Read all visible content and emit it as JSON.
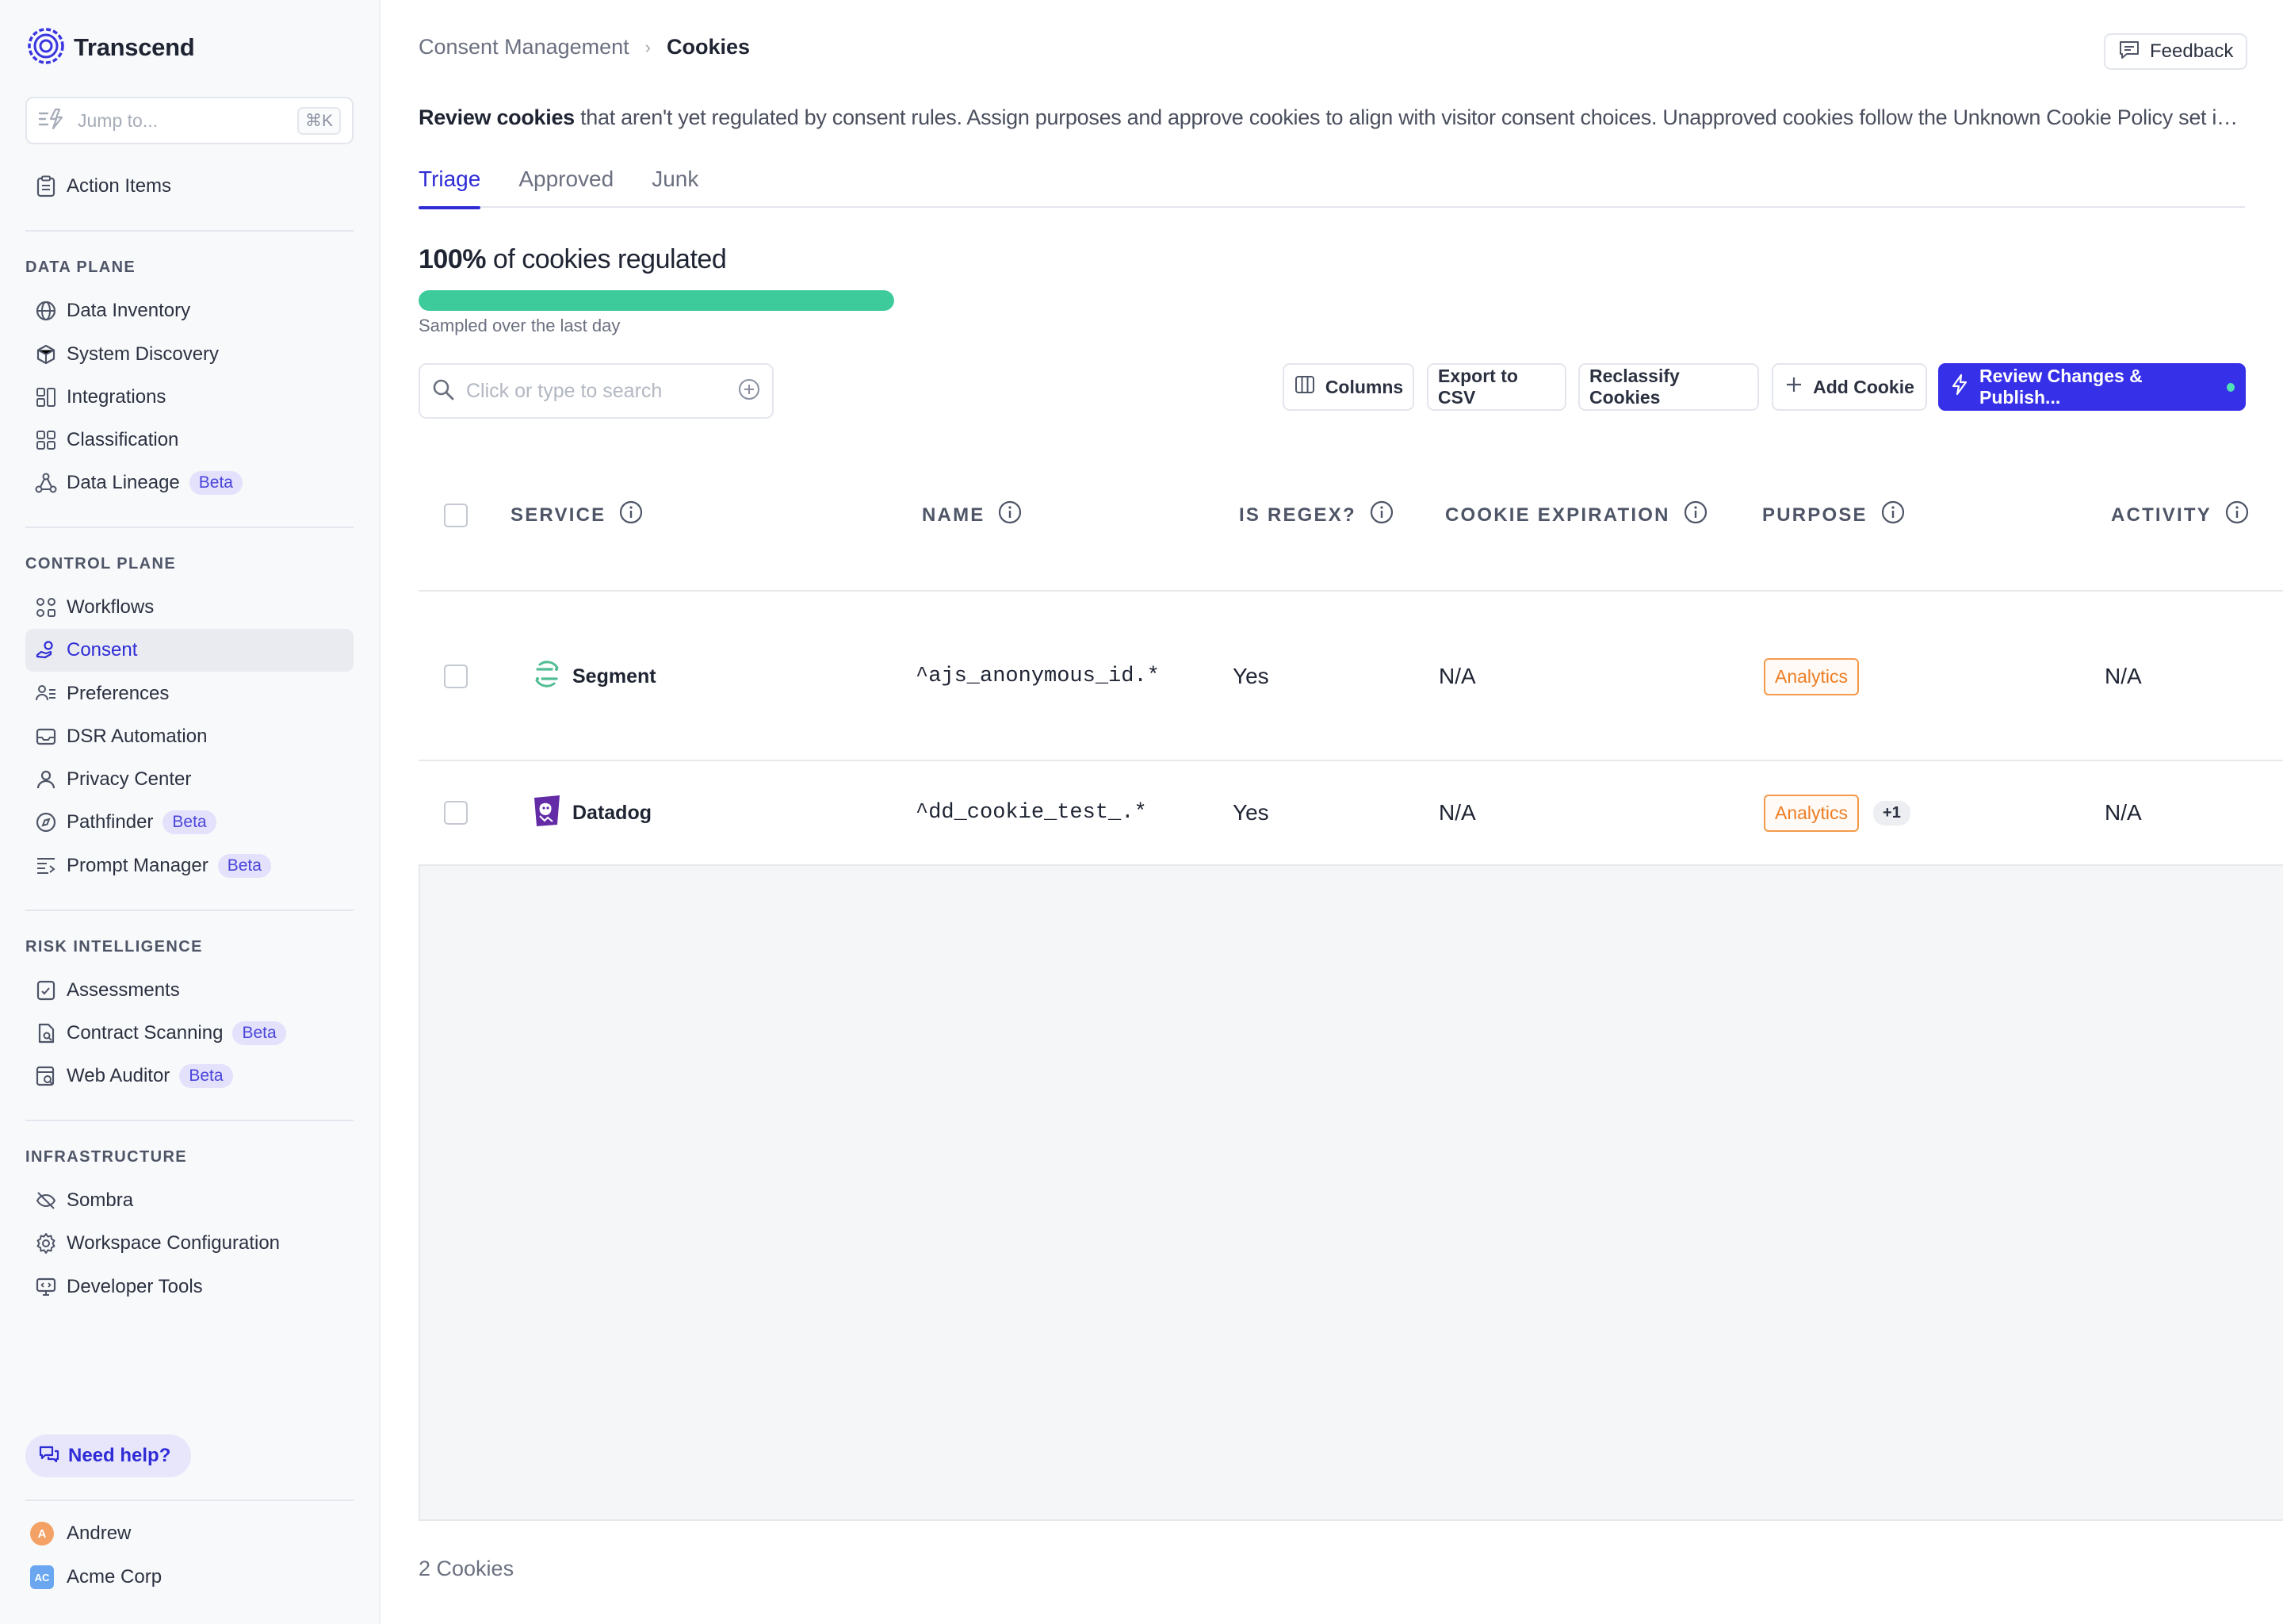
{
  "app": {
    "name": "Transcend"
  },
  "jump": {
    "placeholder": "Jump to...",
    "shortcut": "⌘K"
  },
  "sidebar": {
    "top_items": [
      {
        "label": "Action Items",
        "icon": "clipboard-icon"
      }
    ],
    "sections": [
      {
        "title": "DATA PLANE",
        "items": [
          {
            "label": "Data Inventory",
            "icon": "globe-icon"
          },
          {
            "label": "System Discovery",
            "icon": "cube-icon"
          },
          {
            "label": "Integrations",
            "icon": "integrations-icon"
          },
          {
            "label": "Classification",
            "icon": "grid-icon"
          },
          {
            "label": "Data Lineage",
            "icon": "lineage-icon",
            "badge": "Beta"
          }
        ]
      },
      {
        "title": "CONTROL PLANE",
        "items": [
          {
            "label": "Workflows",
            "icon": "workflows-icon"
          },
          {
            "label": "Consent",
            "icon": "consent-icon",
            "active": true
          },
          {
            "label": "Preferences",
            "icon": "preferences-icon"
          },
          {
            "label": "DSR Automation",
            "icon": "inbox-icon"
          },
          {
            "label": "Privacy Center",
            "icon": "user-icon"
          },
          {
            "label": "Pathfinder",
            "icon": "compass-icon",
            "badge": "Beta"
          },
          {
            "label": "Prompt Manager",
            "icon": "prompt-icon",
            "badge": "Beta"
          }
        ]
      },
      {
        "title": "RISK INTELLIGENCE",
        "items": [
          {
            "label": "Assessments",
            "icon": "assessment-icon"
          },
          {
            "label": "Contract Scanning",
            "icon": "contract-icon",
            "badge": "Beta"
          },
          {
            "label": "Web Auditor",
            "icon": "web-auditor-icon",
            "badge": "Beta"
          }
        ]
      },
      {
        "title": "INFRASTRUCTURE",
        "items": [
          {
            "label": "Sombra",
            "icon": "eye-off-icon"
          },
          {
            "label": "Workspace Configuration",
            "icon": "gear-icon"
          },
          {
            "label": "Developer Tools",
            "icon": "monitor-code-icon"
          }
        ]
      }
    ],
    "help_label": "Need help?",
    "user": {
      "name": "Andrew",
      "initial": "A",
      "color": "#f4a166"
    },
    "org": {
      "name": "Acme Corp",
      "initials": "AC",
      "color": "#6aa7f0"
    }
  },
  "breadcrumb": {
    "parent": "Consent Management",
    "separator": "›",
    "current": "Cookies"
  },
  "feedback_label": "Feedback",
  "description": {
    "bold": "Review cookies",
    "rest": " that aren't yet regulated by consent rules. Assign purposes and approve cookies to align with visitor consent choices. Unapproved cookies follow the Unknown Cookie Policy set in D..."
  },
  "tabs": [
    {
      "label": "Triage",
      "active": true
    },
    {
      "label": "Approved"
    },
    {
      "label": "Junk"
    }
  ],
  "regulated": {
    "percent": "100%",
    "text": " of cookies regulated",
    "fraction": 1.0,
    "subtext": "Sampled over the last day"
  },
  "search": {
    "placeholder": "Click or type to search"
  },
  "toolbar": {
    "columns": "Columns",
    "export": "Export to CSV",
    "reclassify": "Reclassify Cookies",
    "add": "Add Cookie",
    "publish": "Review Changes & Publish..."
  },
  "table": {
    "headers": [
      "SERVICE",
      "NAME",
      "IS REGEX?",
      "COOKIE EXPIRATION",
      "PURPOSE",
      "ACTIVITY"
    ],
    "rows": [
      {
        "service": "Segment",
        "name": "^ajs_anonymous_id.*",
        "is_regex": "Yes",
        "expiration": "N/A",
        "purpose": "Analytics",
        "extra": "",
        "activity": "N/A"
      },
      {
        "service": "Datadog",
        "name": "^dd_cookie_test_.*",
        "is_regex": "Yes",
        "expiration": "N/A",
        "purpose": "Analytics",
        "extra": "+1",
        "activity": "N/A"
      }
    ]
  },
  "footer": {
    "count": "2 Cookies"
  },
  "colors": {
    "accent": "#2f2cd6",
    "primary_button": "#3630e8",
    "progress": "#3ecb9c",
    "tag": "#ee7d24"
  }
}
